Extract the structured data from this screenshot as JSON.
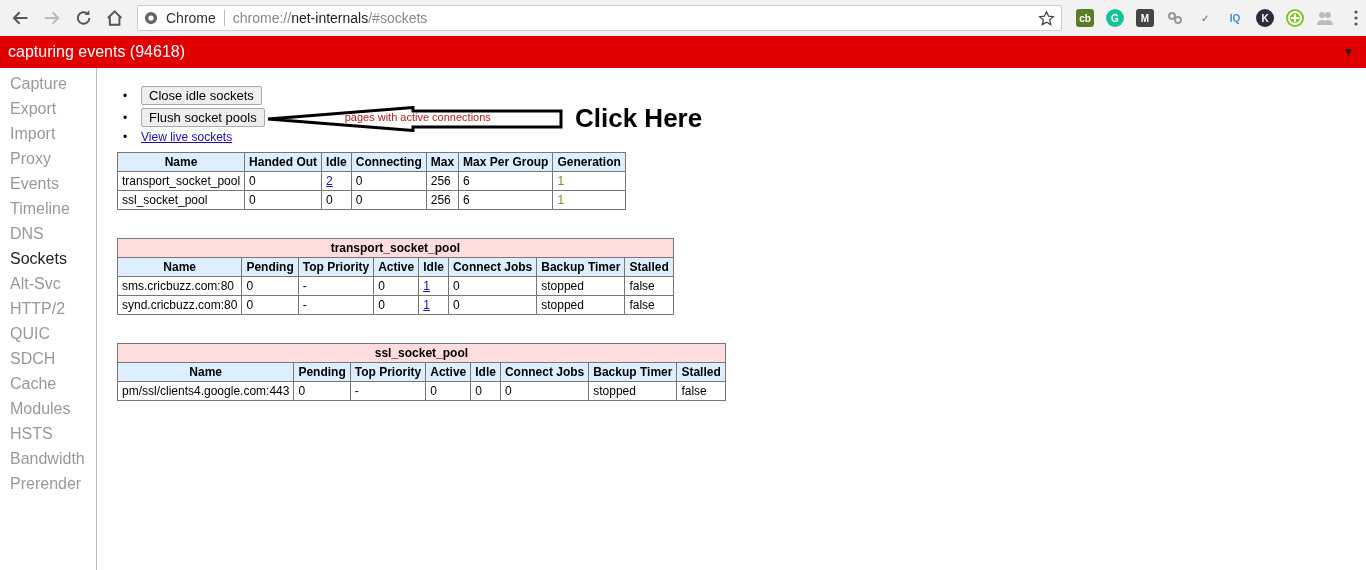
{
  "browser": {
    "site_label": "Chrome",
    "url_prefix": "chrome://",
    "url_host": "net-internals",
    "url_path": "/#sockets",
    "extensions": [
      {
        "kind": "text",
        "text": "cb"
      },
      {
        "kind": "text",
        "text": "G"
      },
      {
        "kind": "text",
        "text": "M"
      },
      {
        "kind": "link"
      },
      {
        "kind": "text",
        "text": "✓"
      },
      {
        "kind": "text",
        "text": "IQ"
      },
      {
        "kind": "text",
        "text": "K"
      },
      {
        "kind": "target"
      },
      {
        "kind": "people"
      }
    ]
  },
  "status_bar": {
    "text": "capturing events (94618)",
    "menu_caret": "▼"
  },
  "sidebar": {
    "items": [
      {
        "label": "Capture",
        "selected": false
      },
      {
        "label": "Export",
        "selected": false
      },
      {
        "label": "Import",
        "selected": false
      },
      {
        "label": "Proxy",
        "selected": false
      },
      {
        "label": "Events",
        "selected": false
      },
      {
        "label": "Timeline",
        "selected": false
      },
      {
        "label": "DNS",
        "selected": false
      },
      {
        "label": "Sockets",
        "selected": true
      },
      {
        "label": "Alt-Svc",
        "selected": false
      },
      {
        "label": "HTTP/2",
        "selected": false
      },
      {
        "label": "QUIC",
        "selected": false
      },
      {
        "label": "SDCH",
        "selected": false
      },
      {
        "label": "Cache",
        "selected": false
      },
      {
        "label": "Modules",
        "selected": false
      },
      {
        "label": "HSTS",
        "selected": false
      },
      {
        "label": "Bandwidth",
        "selected": false
      },
      {
        "label": "Prerender",
        "selected": false
      }
    ]
  },
  "actions": [
    {
      "bullet": "•",
      "kind": "button",
      "text": "Close idle sockets"
    },
    {
      "bullet": "•",
      "kind": "button",
      "text": "Flush socket pools",
      "warning": "pages with active connections"
    },
    {
      "bullet": "•",
      "kind": "link",
      "text": "View live sockets"
    }
  ],
  "annotation": {
    "text": "Click Here"
  },
  "pools_table": {
    "columns": [
      "Name",
      "Handed Out",
      "Idle",
      "Connecting",
      "Max",
      "Max Per Group",
      "Generation"
    ],
    "rows": [
      [
        "transport_socket_pool",
        "0",
        {
          "text": "2",
          "kind": "link"
        },
        "0",
        "256",
        "6",
        {
          "text": "1",
          "kind": "highlight"
        }
      ],
      [
        "ssl_socket_pool",
        "0",
        "0",
        "0",
        "256",
        "6",
        {
          "text": "1",
          "kind": "highlight"
        }
      ]
    ]
  },
  "groups": [
    {
      "title": "transport_socket_pool",
      "columns": [
        "Name",
        "Pending",
        "Top Priority",
        "Active",
        "Idle",
        "Connect Jobs",
        "Backup Timer",
        "Stalled"
      ],
      "rows": [
        [
          "sms.cricbuzz.com:80",
          "0",
          "-",
          "0",
          {
            "text": "1",
            "kind": "link"
          },
          "0",
          "stopped",
          "false"
        ],
        [
          "synd.cricbuzz.com:80",
          "0",
          "-",
          "0",
          {
            "text": "1",
            "kind": "link"
          },
          "0",
          "stopped",
          "false"
        ]
      ]
    },
    {
      "title": "ssl_socket_pool",
      "columns": [
        "Name",
        "Pending",
        "Top Priority",
        "Active",
        "Idle",
        "Connect Jobs",
        "Backup Timer",
        "Stalled"
      ],
      "rows": [
        [
          "pm/ssl/clients4.google.com:443",
          "0",
          "-",
          "0",
          "0",
          "0",
          "stopped",
          "false"
        ]
      ]
    }
  ]
}
